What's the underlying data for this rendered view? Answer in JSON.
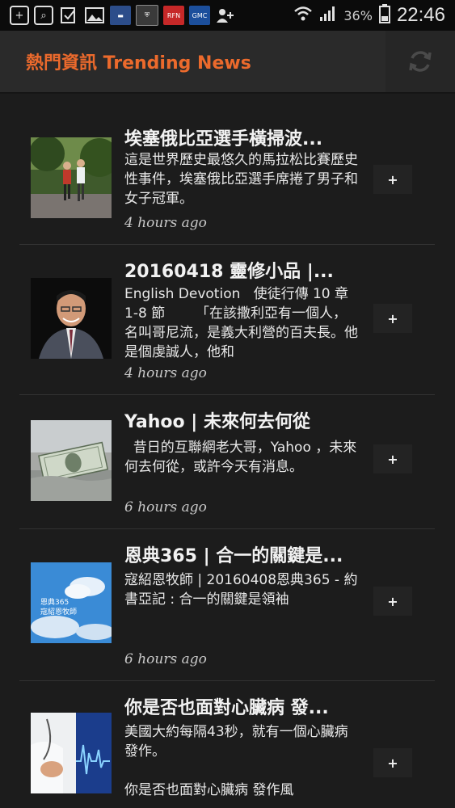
{
  "status_bar": {
    "battery_percent": "36%",
    "time": "22:46",
    "tile_labels": [
      "RFN",
      "GMC"
    ]
  },
  "app_bar": {
    "title": "熱門資訊 Trending News",
    "accent_color": "#ec6a2c",
    "refresh_icon": "refresh-icon"
  },
  "articles": [
    {
      "title": "埃塞俄比亞選手橫掃波...",
      "description": "這是世界歷史最悠久的馬拉松比賽歷史性事件，埃塞俄比亞選手席捲了男子和女子冠軍。",
      "time": "4 hours ago",
      "add_label": "+",
      "thumb": "runners-in-park"
    },
    {
      "title": "20160418 靈修小品 |...",
      "description": "English Devotion   使徒行傳 10 章 1-8 節       「在該撒利亞有一個人，名叫哥尼流，是義大利營的百夫長。他是個虔誠人，他和",
      "time": "4 hours ago",
      "add_label": "+",
      "thumb": "smiling-man-portrait"
    },
    {
      "title": "Yahoo | 未來何去何從",
      "description": "  昔日的互聯網老大哥，Yahoo ，未來何去何從，或許今天有消息。",
      "time": "6 hours ago",
      "add_label": "+",
      "thumb": "dollar-bill-sinking"
    },
    {
      "title": "恩典365 | 合一的關鍵是...",
      "description": "寇紹恩牧師 | 20160408恩典365 - 約書亞記 : 合一的關鍵是領袖",
      "time": "6 hours ago",
      "add_label": "+",
      "thumb": "blue-sky-clouds",
      "thumb_text": "恩典365\n寇紹恩牧師"
    },
    {
      "title": "你是否也面對心臟病 發...",
      "description": "美國大約每隔43秒，就有一個心臟病發作。\n\n你是否也面對心臟病 發作風",
      "time": "",
      "add_label": "+",
      "thumb": "doctor-heartbeat"
    }
  ]
}
